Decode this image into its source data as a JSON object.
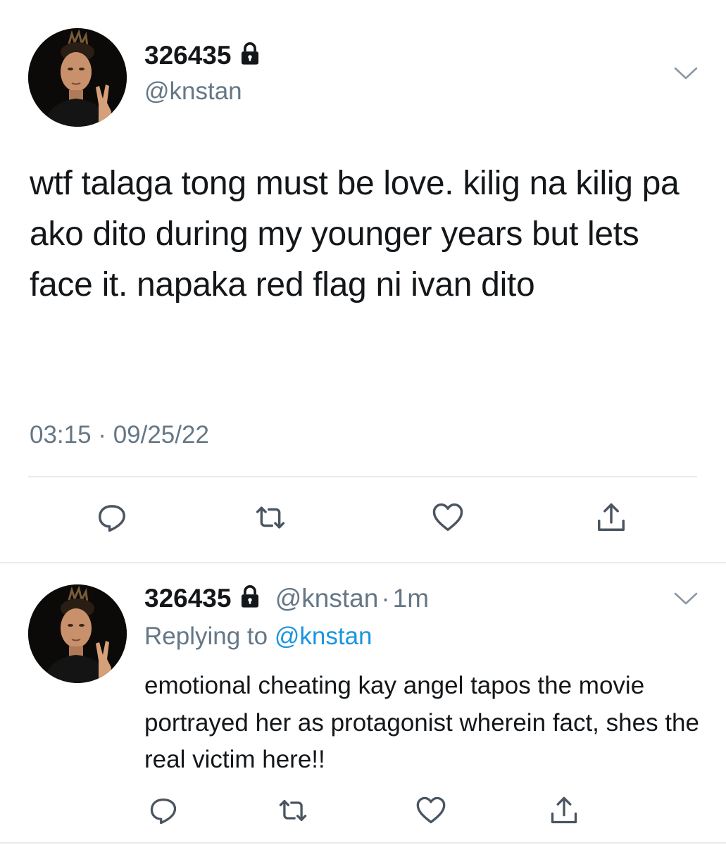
{
  "main_tweet": {
    "display_name": "326435",
    "handle": "@knstan",
    "text": "wtf talaga tong must be love. kilig na kilig pa ako dito during my younger years but lets face it. napaka red flag ni ivan dito",
    "timestamp": "03:15 · 09/25/22",
    "icons": {
      "lock": "lock-icon",
      "menu": "chevron-down-icon",
      "reply": "reply-icon",
      "retweet": "retweet-icon",
      "like": "heart-icon",
      "share": "share-icon"
    }
  },
  "reply_tweet": {
    "display_name": "326435",
    "handle": "@knstan",
    "separator": "·",
    "time": "1m",
    "replying_prefix": "Replying to",
    "replying_mention": "@knstan",
    "text": "emotional cheating kay angel tapos the movie portrayed her as protagonist wherein fact, shes the real victim here!!"
  },
  "colors": {
    "text": "#14171a",
    "secondary": "#657786",
    "link": "#1b95e0",
    "divider": "#e6ecf0"
  }
}
